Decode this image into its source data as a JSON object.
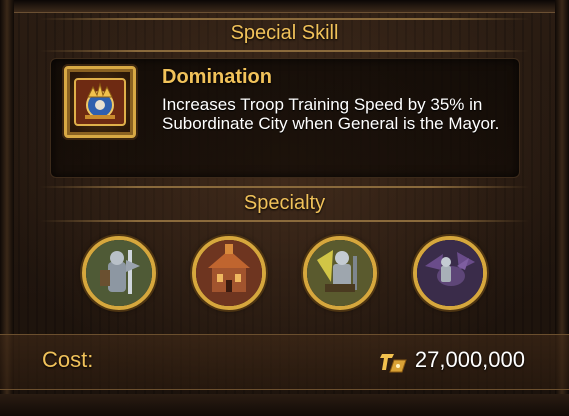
{
  "special_skill": {
    "section_title": "Special Skill",
    "icon": "crown-book-icon",
    "name": "Domination",
    "description": "Increases Troop Training Speed by 35% in Subordinate City when General is the Mayor."
  },
  "specialty": {
    "section_title": "Specialty",
    "items": [
      {
        "icon": "infantry-knight-icon"
      },
      {
        "icon": "city-building-icon"
      },
      {
        "icon": "armored-soldier-icon"
      },
      {
        "icon": "dragon-rider-icon"
      }
    ]
  },
  "cost": {
    "label": "Cost:",
    "icon": "gold-currency-icon",
    "value": "27,000,000"
  },
  "colors": {
    "accent_gold": "#f1c25a",
    "text_white": "#ffffff",
    "frame_gold": "#d6a73d"
  }
}
